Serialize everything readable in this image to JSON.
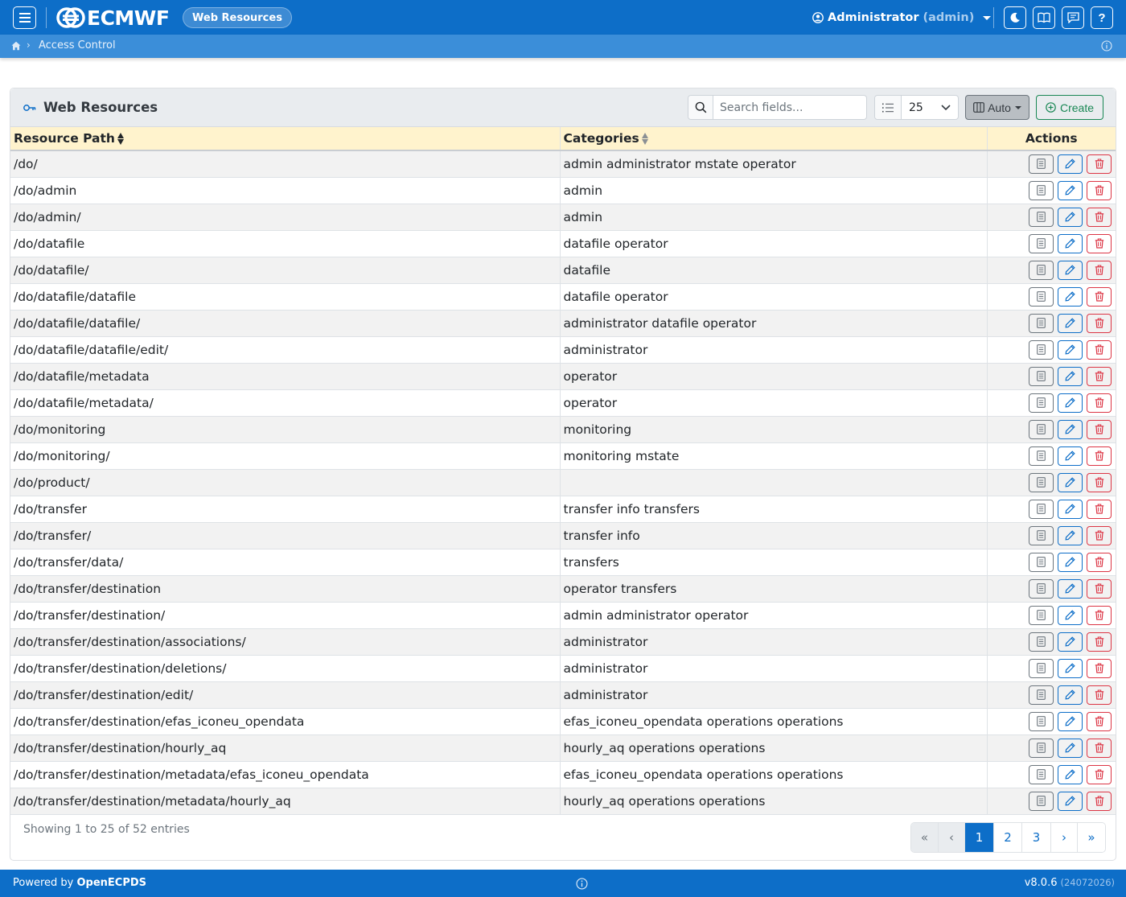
{
  "app": {
    "logo_text": "ECMWF",
    "section_pill": "Web Resources",
    "user_name": "Administrator",
    "user_login": "(admin)"
  },
  "icons": {
    "menu": "hamburger-icon",
    "theme": "moon-icon",
    "docs": "book-icon",
    "messages": "chat-icon",
    "help": "question-icon",
    "help_label": "?"
  },
  "breadcrumb": {
    "current": "Access Control"
  },
  "card": {
    "title": "Web Resources",
    "search_placeholder": "Search fields...",
    "page_length": "25",
    "columns_button": "Auto",
    "create_button": "Create"
  },
  "table": {
    "headers": [
      "Resource Path",
      "Categories",
      "Actions"
    ],
    "rows": [
      {
        "path": "/do/",
        "categories": "admin administrator mstate operator"
      },
      {
        "path": "/do/admin",
        "categories": "admin"
      },
      {
        "path": "/do/admin/",
        "categories": "admin"
      },
      {
        "path": "/do/datafile",
        "categories": "datafile operator"
      },
      {
        "path": "/do/datafile/",
        "categories": "datafile"
      },
      {
        "path": "/do/datafile/datafile",
        "categories": "datafile operator"
      },
      {
        "path": "/do/datafile/datafile/",
        "categories": "administrator datafile operator"
      },
      {
        "path": "/do/datafile/datafile/edit/",
        "categories": "administrator"
      },
      {
        "path": "/do/datafile/metadata",
        "categories": "operator"
      },
      {
        "path": "/do/datafile/metadata/",
        "categories": "operator"
      },
      {
        "path": "/do/monitoring",
        "categories": "monitoring"
      },
      {
        "path": "/do/monitoring/",
        "categories": "monitoring mstate"
      },
      {
        "path": "/do/product/",
        "categories": ""
      },
      {
        "path": "/do/transfer",
        "categories": "transfer info transfers"
      },
      {
        "path": "/do/transfer/",
        "categories": "transfer info"
      },
      {
        "path": "/do/transfer/data/",
        "categories": "transfers"
      },
      {
        "path": "/do/transfer/destination",
        "categories": "operator transfers"
      },
      {
        "path": "/do/transfer/destination/",
        "categories": "admin administrator operator"
      },
      {
        "path": "/do/transfer/destination/associations/",
        "categories": "administrator"
      },
      {
        "path": "/do/transfer/destination/deletions/",
        "categories": "administrator"
      },
      {
        "path": "/do/transfer/destination/edit/",
        "categories": "administrator"
      },
      {
        "path": "/do/transfer/destination/efas_iconeu_opendata",
        "categories": "efas_iconeu_opendata operations operations"
      },
      {
        "path": "/do/transfer/destination/hourly_aq",
        "categories": "hourly_aq operations operations"
      },
      {
        "path": "/do/transfer/destination/metadata/efas_iconeu_opendata",
        "categories": "efas_iconeu_opendata operations operations"
      },
      {
        "path": "/do/transfer/destination/metadata/hourly_aq",
        "categories": "hourly_aq operations operations"
      }
    ]
  },
  "footer": {
    "info": "Showing 1 to 25 of 52 entries",
    "pages": [
      {
        "label": "«",
        "state": "disabled"
      },
      {
        "label": "‹",
        "state": "disabled"
      },
      {
        "label": "1",
        "state": "active"
      },
      {
        "label": "2",
        "state": "normal"
      },
      {
        "label": "3",
        "state": "normal"
      },
      {
        "label": "›",
        "state": "normal"
      },
      {
        "label": "»",
        "state": "normal"
      }
    ]
  },
  "bottombar": {
    "powered_prefix": "Powered by",
    "powered_name": "OpenECPDS",
    "version_prefix": "v",
    "version": "8.0.6",
    "build": "(24072026)"
  },
  "colors": {
    "primary": "#0d6ec8",
    "breadcrumb": "#3b8ed9",
    "header_row": "#fff3cd",
    "success": "#198754",
    "danger": "#dc3545"
  }
}
